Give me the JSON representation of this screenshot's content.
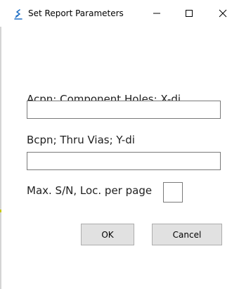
{
  "window": {
    "title": "Set Report Parameters",
    "icon": "app-icon",
    "controls": {
      "minimize": "minimize-icon",
      "maximize": "maximize-icon",
      "close": "close-icon"
    }
  },
  "form": {
    "field_a": {
      "label": "Acpn; Component Holes; X-di",
      "value": ""
    },
    "field_b": {
      "label": "Bcpn; Thru Vias; Y-di",
      "value": ""
    },
    "field_c": {
      "label": "Max. S/N, Loc. per page",
      "value": ""
    }
  },
  "buttons": {
    "ok_label": "OK",
    "cancel_label": "Cancel"
  },
  "colors": {
    "button_face": "#e1e1e1",
    "button_border": "#adadad",
    "field_border": "#7a7a7a",
    "icon_blue": "#1f6fc5"
  }
}
